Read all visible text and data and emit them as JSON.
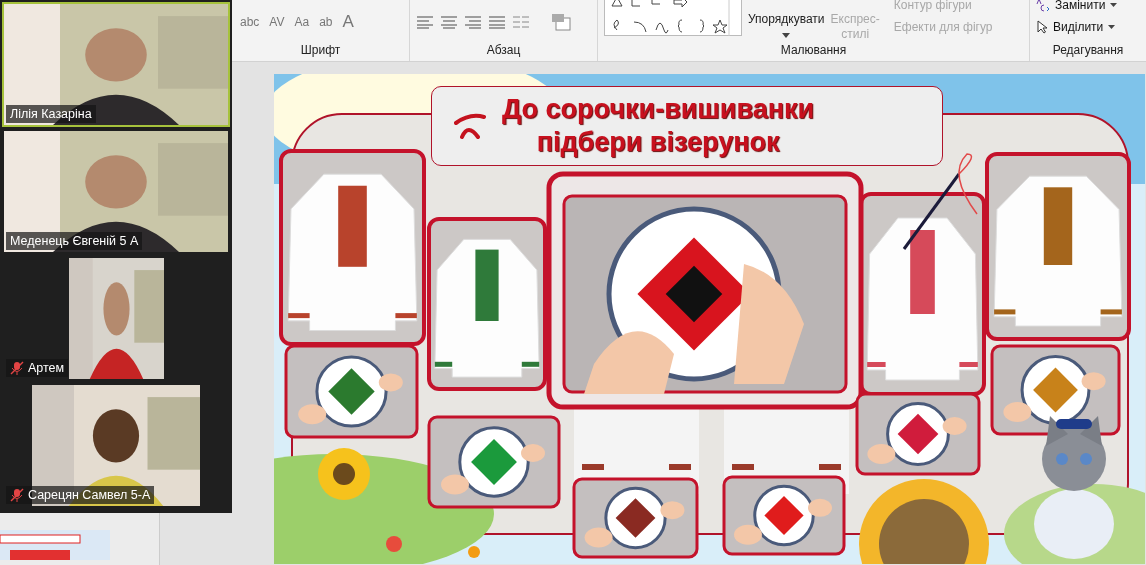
{
  "ribbon": {
    "font_group": {
      "label": "Шрифт",
      "tools": [
        "abc",
        "AV",
        "Aa",
        "ab",
        "A"
      ]
    },
    "paragraph_group": {
      "label": "Абзац"
    },
    "drawing_group": {
      "label": "Малювання",
      "arrange": "Упорядкувати",
      "quick_styles": {
        "lines": [
          "Експрес-",
          "стилі"
        ],
        "disabled": true
      },
      "effects": [
        {
          "text": "Контур фігури",
          "disabled": true
        },
        {
          "text": "Ефекти для фігур",
          "disabled": true
        }
      ]
    },
    "editing_group": {
      "label": "Редагування",
      "commands": [
        {
          "text": "Замінити",
          "kind": "replace"
        },
        {
          "text": "Виділити",
          "kind": "select"
        }
      ]
    }
  },
  "participants": [
    {
      "name": "Лілія Казаріна",
      "muted": false,
      "active_speaker": true,
      "kind": "wide"
    },
    {
      "name": "Меденець Євгеній 5 А",
      "muted": false,
      "active_speaker": false,
      "kind": "wide"
    },
    {
      "name": "Артем",
      "muted": true,
      "active_speaker": false,
      "kind": "narrow"
    },
    {
      "name": "Сарецян Самвел 5-А",
      "muted": true,
      "active_speaker": false,
      "kind": "medium"
    }
  ],
  "slide": {
    "title_lines": [
      "До сорочки-вишиванки",
      "підбери візерунок"
    ]
  }
}
